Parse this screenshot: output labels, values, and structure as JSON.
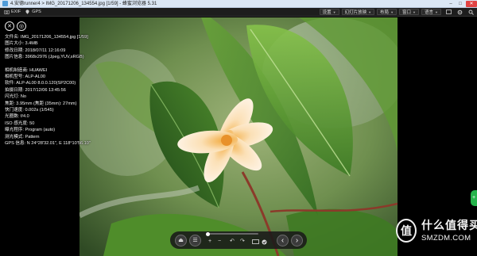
{
  "window": {
    "title": "4.安德runner4 > IMG_20171206_134554.jpg [1/59] - 蜂蜜浏览器 5.31",
    "min_glyph": "–",
    "max_glyph": "□",
    "close_glyph": "✕"
  },
  "toolbar": {
    "exif_label": "EXIF",
    "gps_label": "GPS",
    "right_items": [
      {
        "label": "设置"
      },
      {
        "label": "幻灯片放映"
      },
      {
        "label": "布局"
      },
      {
        "label": "窗口"
      },
      {
        "label": "语言"
      }
    ],
    "right_icons": [
      "fullscreen-icon",
      "gear-icon",
      "search-icon"
    ]
  },
  "overlay": {
    "close_glyph": "✕",
    "info_glyph": "◎"
  },
  "file_info": [
    "文件名: IMG_20171206_134554.jpg [1/59]",
    "图片大小: 3.4MB",
    "修改日期: 2018/07/11 12:16:09",
    "图片信息: 3968x2976 (Jpeg,YUV,sRGB)"
  ],
  "exif_info": [
    "相机制造商: HUAWEI",
    "相机型号: ALP-AL00",
    "软件: ALP-AL00 8.0.0.120(SP2C00)",
    "拍摄日期: 2017/12/06 13:45:56",
    "闪光灯: No",
    "焦距: 3.95mm (焦距 (35mm): 27mm)",
    "快门速度: 0.002s (1/545)",
    "光圈数: f/4.0",
    "ISO 感光度: 50",
    "曝光程序: Program (auto)",
    "测光模式: Pattern",
    "GPS 信息: N 24°28'32.01\", E 118°10'56.10\""
  ],
  "controls": {
    "eject_glyph": "⏏",
    "menu_glyph": "☰",
    "zoom_in": "+",
    "zoom_out": "−",
    "rotate_left": "↶",
    "rotate_right": "↷",
    "prev_glyph": "‹",
    "next_glyph": "›",
    "seek_position": 0.0
  },
  "watermark": {
    "badge": "值",
    "text_cn": "什么值得买",
    "text_en": "SMZDM.COM"
  },
  "colors": {
    "accent_green": "#25b34b",
    "close_red": "#e04343"
  }
}
